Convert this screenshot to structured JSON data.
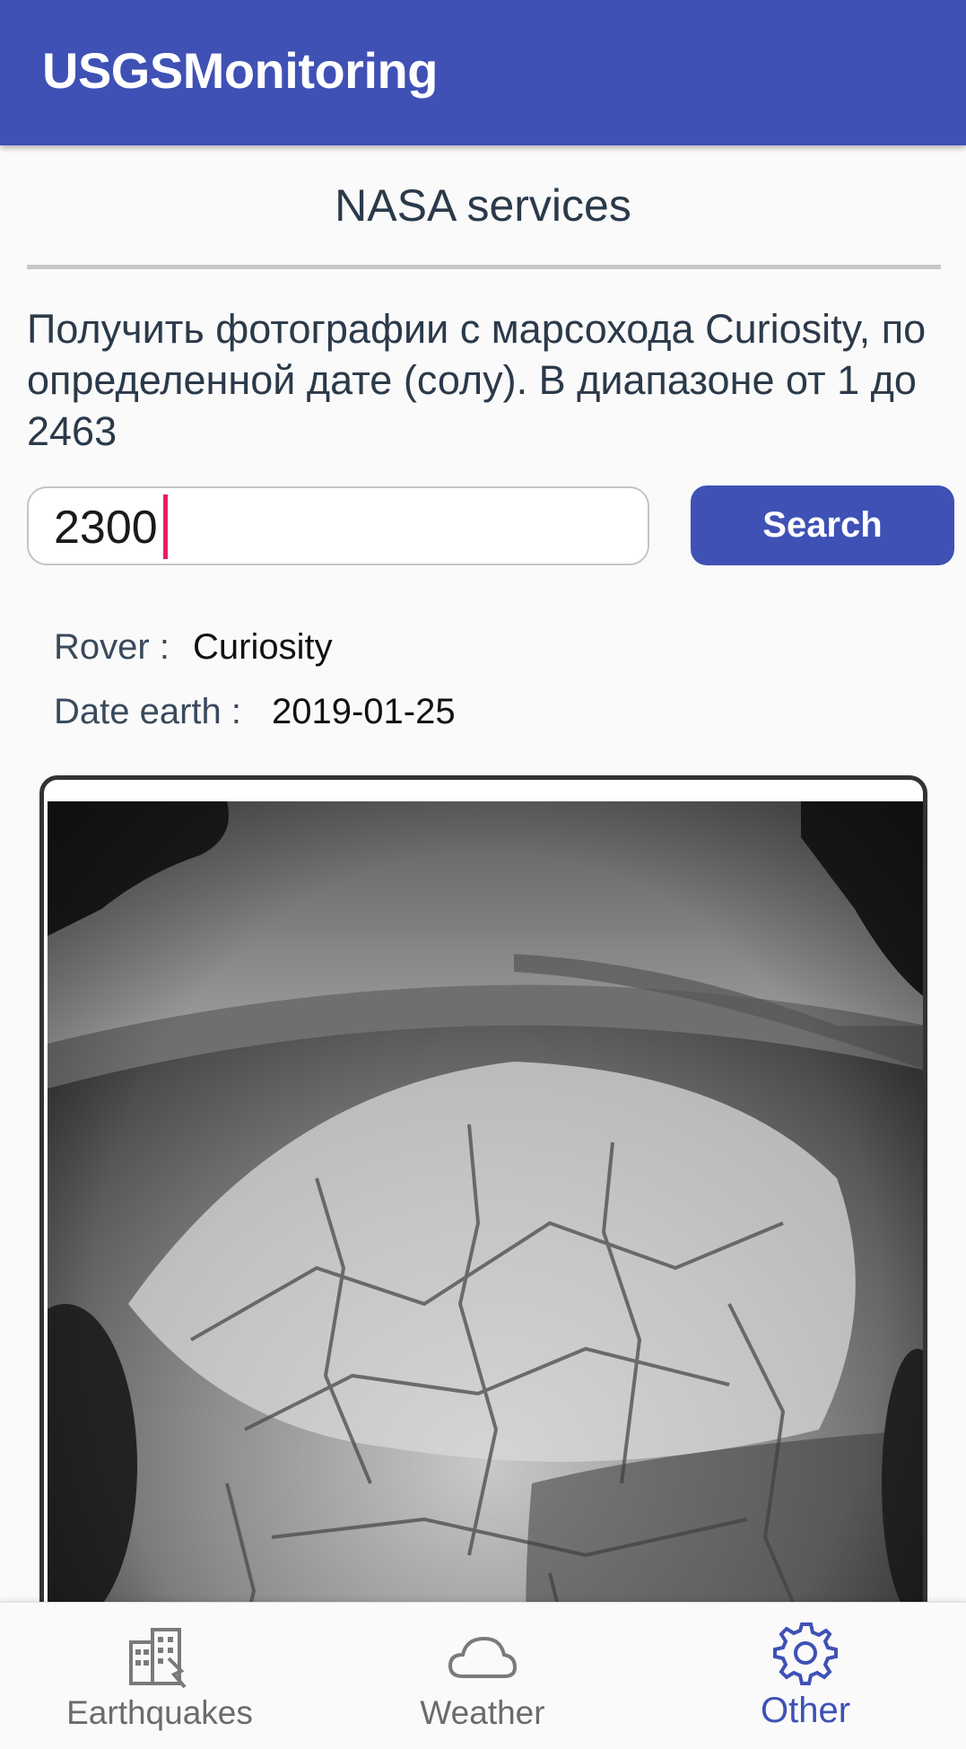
{
  "app_bar": {
    "title": "USGSMonitoring",
    "color": "#3f51b5"
  },
  "section": {
    "title": "NASA services"
  },
  "description": "Получить фотографии с марсохода Curiosity, по определенной дате (солу). В диапазоне от 1 до 2463",
  "search": {
    "value": "2300",
    "button_label": "Search"
  },
  "info": {
    "rover_label": "Rover :",
    "rover_value": "Curiosity",
    "date_label": "Date earth :",
    "date_value": "2019-01-25"
  },
  "photo": {
    "icon": "mars-rover-photo"
  },
  "bottom_nav": {
    "items": [
      {
        "label": "Earthquakes",
        "icon": "buildings-icon",
        "active": false
      },
      {
        "label": "Weather",
        "icon": "cloud-icon",
        "active": false
      },
      {
        "label": "Other",
        "icon": "gear-icon",
        "active": true
      }
    ],
    "active_color": "#3f51b5",
    "inactive_color": "#6b6b6b"
  }
}
